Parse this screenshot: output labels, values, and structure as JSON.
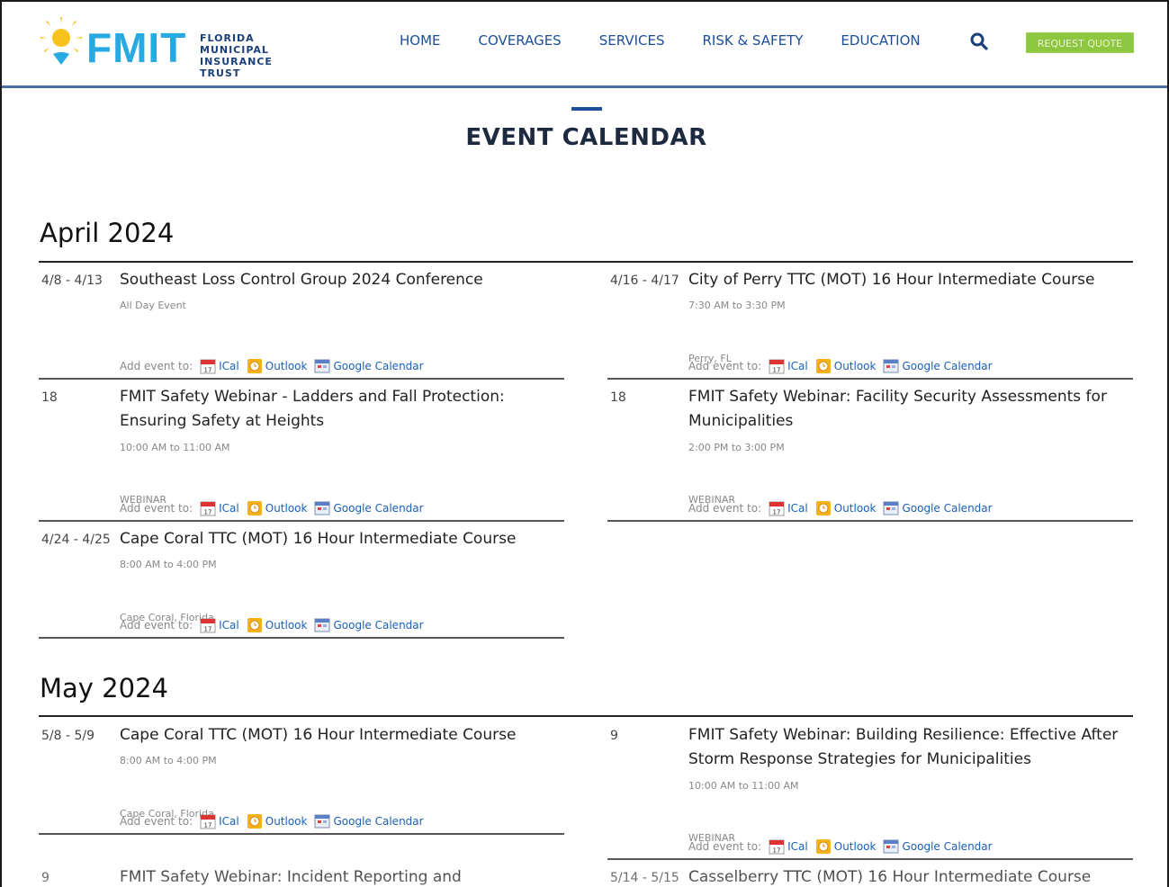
{
  "brand": {
    "logo_text": "FMIT",
    "logo_sub": [
      "FLORIDA",
      "MUNICIPAL",
      "INSURANCE TRUST"
    ],
    "colors": {
      "primary": "#1b4f9a",
      "accent": "#27aae1",
      "sun": "#f7c21b",
      "quote": "#8dc63f"
    }
  },
  "nav": {
    "items": [
      "HOME",
      "COVERAGES",
      "SERVICES",
      "RISK & SAFETY",
      "EDUCATION"
    ],
    "search_icon": "search-icon",
    "quote_label": "REQUEST QUOTE"
  },
  "page": {
    "title": "EVENT CALENDAR"
  },
  "add_label": "Add event to:",
  "add_links": [
    "ICal",
    "Outlook",
    "Google Calendar"
  ],
  "months": [
    {
      "label": "April 2024",
      "events": [
        {
          "date": "4/8 - 4/13",
          "title": "Southeast Loss Control Group 2024 Conference",
          "time": "All Day Event",
          "location": ""
        },
        {
          "date": "4/16 - 4/17",
          "title": "City of Perry TTC (MOT) 16 Hour Intermediate Course",
          "time": "7:30 AM to 3:30 PM",
          "location": "Perry, FL"
        },
        {
          "date": "18",
          "title": "FMIT Safety Webinar - Ladders and Fall Protection: Ensuring Safety at Heights",
          "time": "10:00 AM to 11:00 AM",
          "location": "WEBINAR"
        },
        {
          "date": "18",
          "title": "FMIT Safety Webinar: Facility Security Assessments for Municipalities",
          "time": "2:00 PM to 3:00 PM",
          "location": "WEBINAR"
        },
        {
          "date": "4/24 - 4/25",
          "title": "Cape Coral TTC (MOT) 16 Hour Intermediate Course",
          "time": "8:00 AM to 4:00 PM",
          "location": "Cape Coral, Florida"
        }
      ]
    },
    {
      "label": "May 2024",
      "events": [
        {
          "date": "5/8 - 5/9",
          "title": "Cape Coral TTC (MOT) 16 Hour Intermediate Course",
          "time": "8:00 AM to 4:00 PM",
          "location": "Cape Coral, Florida"
        },
        {
          "date": "9",
          "title": "FMIT Safety Webinar: Building Resilience: Effective After Storm Response Strategies for Municipalities",
          "time": "10:00 AM to 11:00 AM",
          "location": "WEBINAR"
        },
        {
          "date": "9",
          "title": "FMIT Safety Webinar: Incident Reporting and",
          "time": "",
          "location": ""
        },
        {
          "date": "5/14 - 5/15",
          "title": "Casselberry TTC (MOT) 16 Hour Intermediate Course",
          "time": "",
          "location": ""
        }
      ]
    }
  ]
}
